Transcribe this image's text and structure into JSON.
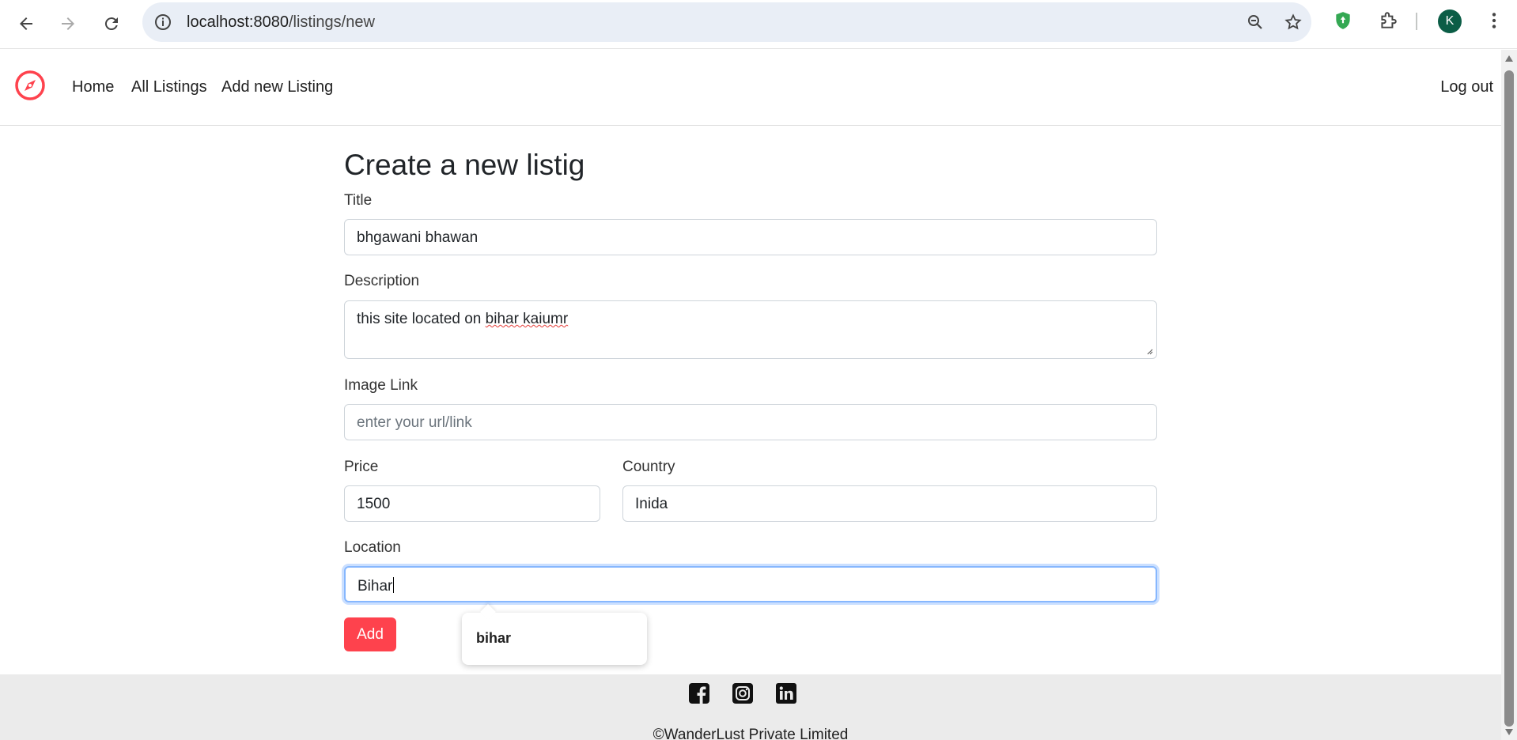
{
  "browser": {
    "url_host": "localhost:8080",
    "url_path": "/listings/new",
    "profile_initial": "K"
  },
  "nav": {
    "home": "Home",
    "all_listings": "All Listings",
    "add_listing": "Add new Listing",
    "logout": "Log out"
  },
  "form": {
    "heading": "Create a new listig",
    "title_label": "Title",
    "title_value": "bhgawani bhawan",
    "description_label": "Description",
    "description_value_plain": "this site located on ",
    "description_value_misspelled": "bihar kaiumr",
    "image_label": "Image Link",
    "image_placeholder": "enter your url/link",
    "price_label": "Price",
    "price_value": "1500",
    "country_label": "Country",
    "country_value": "Inida",
    "location_label": "Location",
    "location_value": "Bihar",
    "submit_label": "Add"
  },
  "autocomplete": {
    "suggestion": "bihar"
  },
  "footer": {
    "copyright": "©WanderLust Private Limited"
  },
  "colors": {
    "brand": "#fe424d",
    "focus": "#86b7fe"
  }
}
